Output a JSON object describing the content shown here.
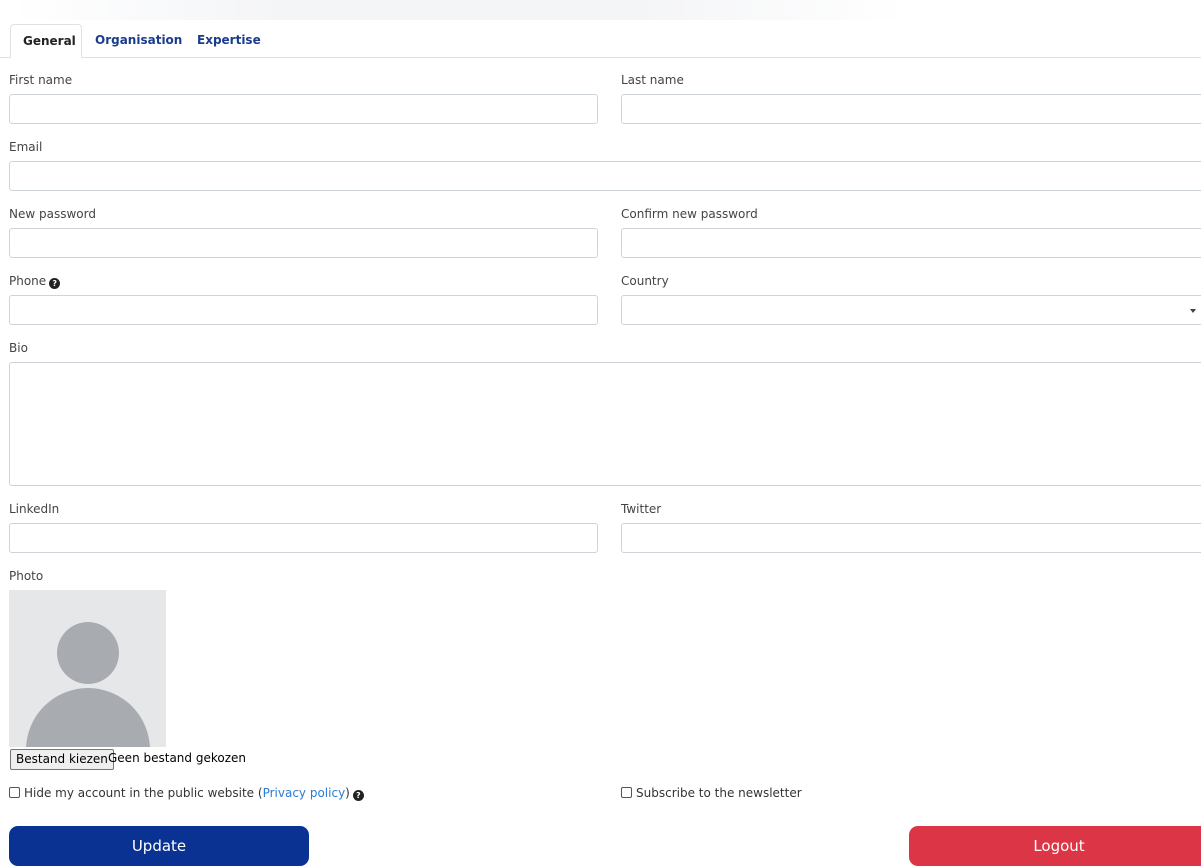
{
  "tabs": [
    {
      "label": "General",
      "active": true
    },
    {
      "label": "Organisation",
      "active": false
    },
    {
      "label": "Expertise",
      "active": false
    }
  ],
  "fields": {
    "first_name": {
      "label": "First name",
      "value": ""
    },
    "last_name": {
      "label": "Last name",
      "value": ""
    },
    "email": {
      "label": "Email",
      "value": ""
    },
    "new_password": {
      "label": "New password",
      "value": ""
    },
    "confirm_password": {
      "label": "Confirm new password",
      "value": ""
    },
    "phone": {
      "label": "Phone",
      "value": "",
      "help_icon": "question-circle-icon"
    },
    "country": {
      "label": "Country",
      "value": ""
    },
    "bio": {
      "label": "Bio",
      "value": ""
    },
    "linkedin": {
      "label": "LinkedIn",
      "value": ""
    },
    "twitter": {
      "label": "Twitter",
      "value": ""
    }
  },
  "photo": {
    "label": "Photo",
    "placeholder_icon": "avatar-placeholder-icon",
    "choose_file_label": "Bestand kiezen",
    "file_status": "Geen bestand gekozen"
  },
  "options": {
    "hide_account": {
      "text_before": "Hide my account in the public website (",
      "link": "Privacy policy",
      "text_after": ")",
      "checked": false
    },
    "newsletter": {
      "label": "Subscribe to the newsletter",
      "checked": false
    }
  },
  "buttons": {
    "update": "Update",
    "logout": "Logout"
  },
  "colors": {
    "primary": "#0a3293",
    "danger": "#dc3545",
    "link": "#2b7bd8",
    "tab_link": "#1b3c8c"
  }
}
